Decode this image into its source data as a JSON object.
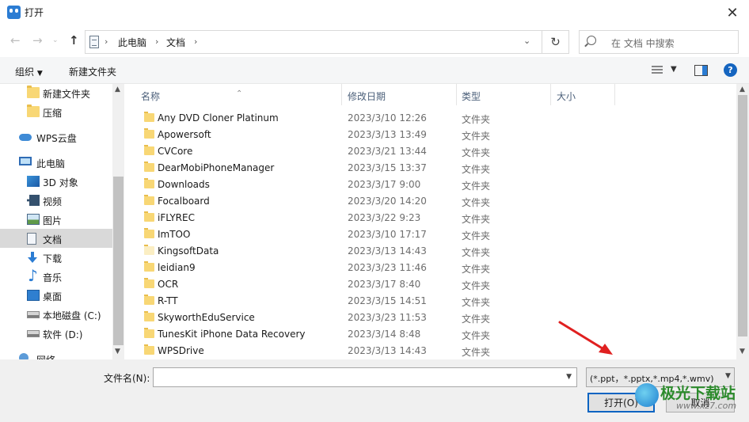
{
  "window": {
    "title": "打开"
  },
  "address_bar": {
    "crumbs": [
      "此电脑",
      "文档"
    ]
  },
  "search": {
    "placeholder": "在 文档 中搜索"
  },
  "toolbar": {
    "organize": "组织",
    "new_folder": "新建文件夹"
  },
  "sidebar": {
    "items": [
      {
        "label": "新建文件夹",
        "icon": "folder-icon"
      },
      {
        "label": "压缩",
        "icon": "folder-icon"
      },
      {
        "label": "WPS云盘",
        "icon": "cloud-icon"
      },
      {
        "label": "此电脑",
        "icon": "pc-icon"
      },
      {
        "label": "3D 对象",
        "icon": "cube-icon"
      },
      {
        "label": "视频",
        "icon": "video-icon"
      },
      {
        "label": "图片",
        "icon": "image-icon"
      },
      {
        "label": "文档",
        "icon": "document-icon",
        "selected": true
      },
      {
        "label": "下载",
        "icon": "download-icon"
      },
      {
        "label": "音乐",
        "icon": "music-icon"
      },
      {
        "label": "桌面",
        "icon": "desktop-icon"
      },
      {
        "label": "本地磁盘 (C:)",
        "icon": "drive-icon"
      },
      {
        "label": "软件 (D:)",
        "icon": "drive-icon"
      },
      {
        "label": "网络",
        "icon": "network-icon"
      }
    ]
  },
  "columns": {
    "name": "名称",
    "modified": "修改日期",
    "type": "类型",
    "size": "大小"
  },
  "files": [
    {
      "name": "Any DVD Cloner Platinum",
      "modified": "2023/3/10 12:26",
      "type": "文件夹"
    },
    {
      "name": "Apowersoft",
      "modified": "2023/3/13 13:49",
      "type": "文件夹"
    },
    {
      "name": "CVCore",
      "modified": "2023/3/21 13:44",
      "type": "文件夹"
    },
    {
      "name": "DearMobiPhoneManager",
      "modified": "2023/3/15 13:37",
      "type": "文件夹"
    },
    {
      "name": "Downloads",
      "modified": "2023/3/17 9:00",
      "type": "文件夹"
    },
    {
      "name": "Focalboard",
      "modified": "2023/3/20 14:20",
      "type": "文件夹"
    },
    {
      "name": "iFLYREC",
      "modified": "2023/3/22 9:23",
      "type": "文件夹"
    },
    {
      "name": "ImTOO",
      "modified": "2023/3/10 17:17",
      "type": "文件夹"
    },
    {
      "name": "KingsoftData",
      "modified": "2023/3/13 14:43",
      "type": "文件夹",
      "pale": true
    },
    {
      "name": "leidian9",
      "modified": "2023/3/23 11:46",
      "type": "文件夹"
    },
    {
      "name": "OCR",
      "modified": "2023/3/17 8:40",
      "type": "文件夹"
    },
    {
      "name": "R-TT",
      "modified": "2023/3/15 14:51",
      "type": "文件夹"
    },
    {
      "name": "SkyworthEduService",
      "modified": "2023/3/23 11:53",
      "type": "文件夹"
    },
    {
      "name": "TunesKit iPhone Data Recovery",
      "modified": "2023/3/14 8:48",
      "type": "文件夹"
    },
    {
      "name": "WPSDrive",
      "modified": "2023/3/13 14:43",
      "type": "文件夹"
    }
  ],
  "footer": {
    "filename_label": "文件名(N):",
    "filename_value": "",
    "filter_value": "(*.ppt，*.pptx,*.mp4,*.wmv)",
    "open_label": "打开(O)",
    "cancel_label": "取消"
  },
  "watermark": {
    "main": "极光下载站",
    "sub": "www.xz7.com"
  },
  "colors": {
    "accent": "#0a64c2",
    "folder": "#f8d775",
    "annotation_arrow": "#e02020",
    "selected_row": "#d9d9d9"
  }
}
